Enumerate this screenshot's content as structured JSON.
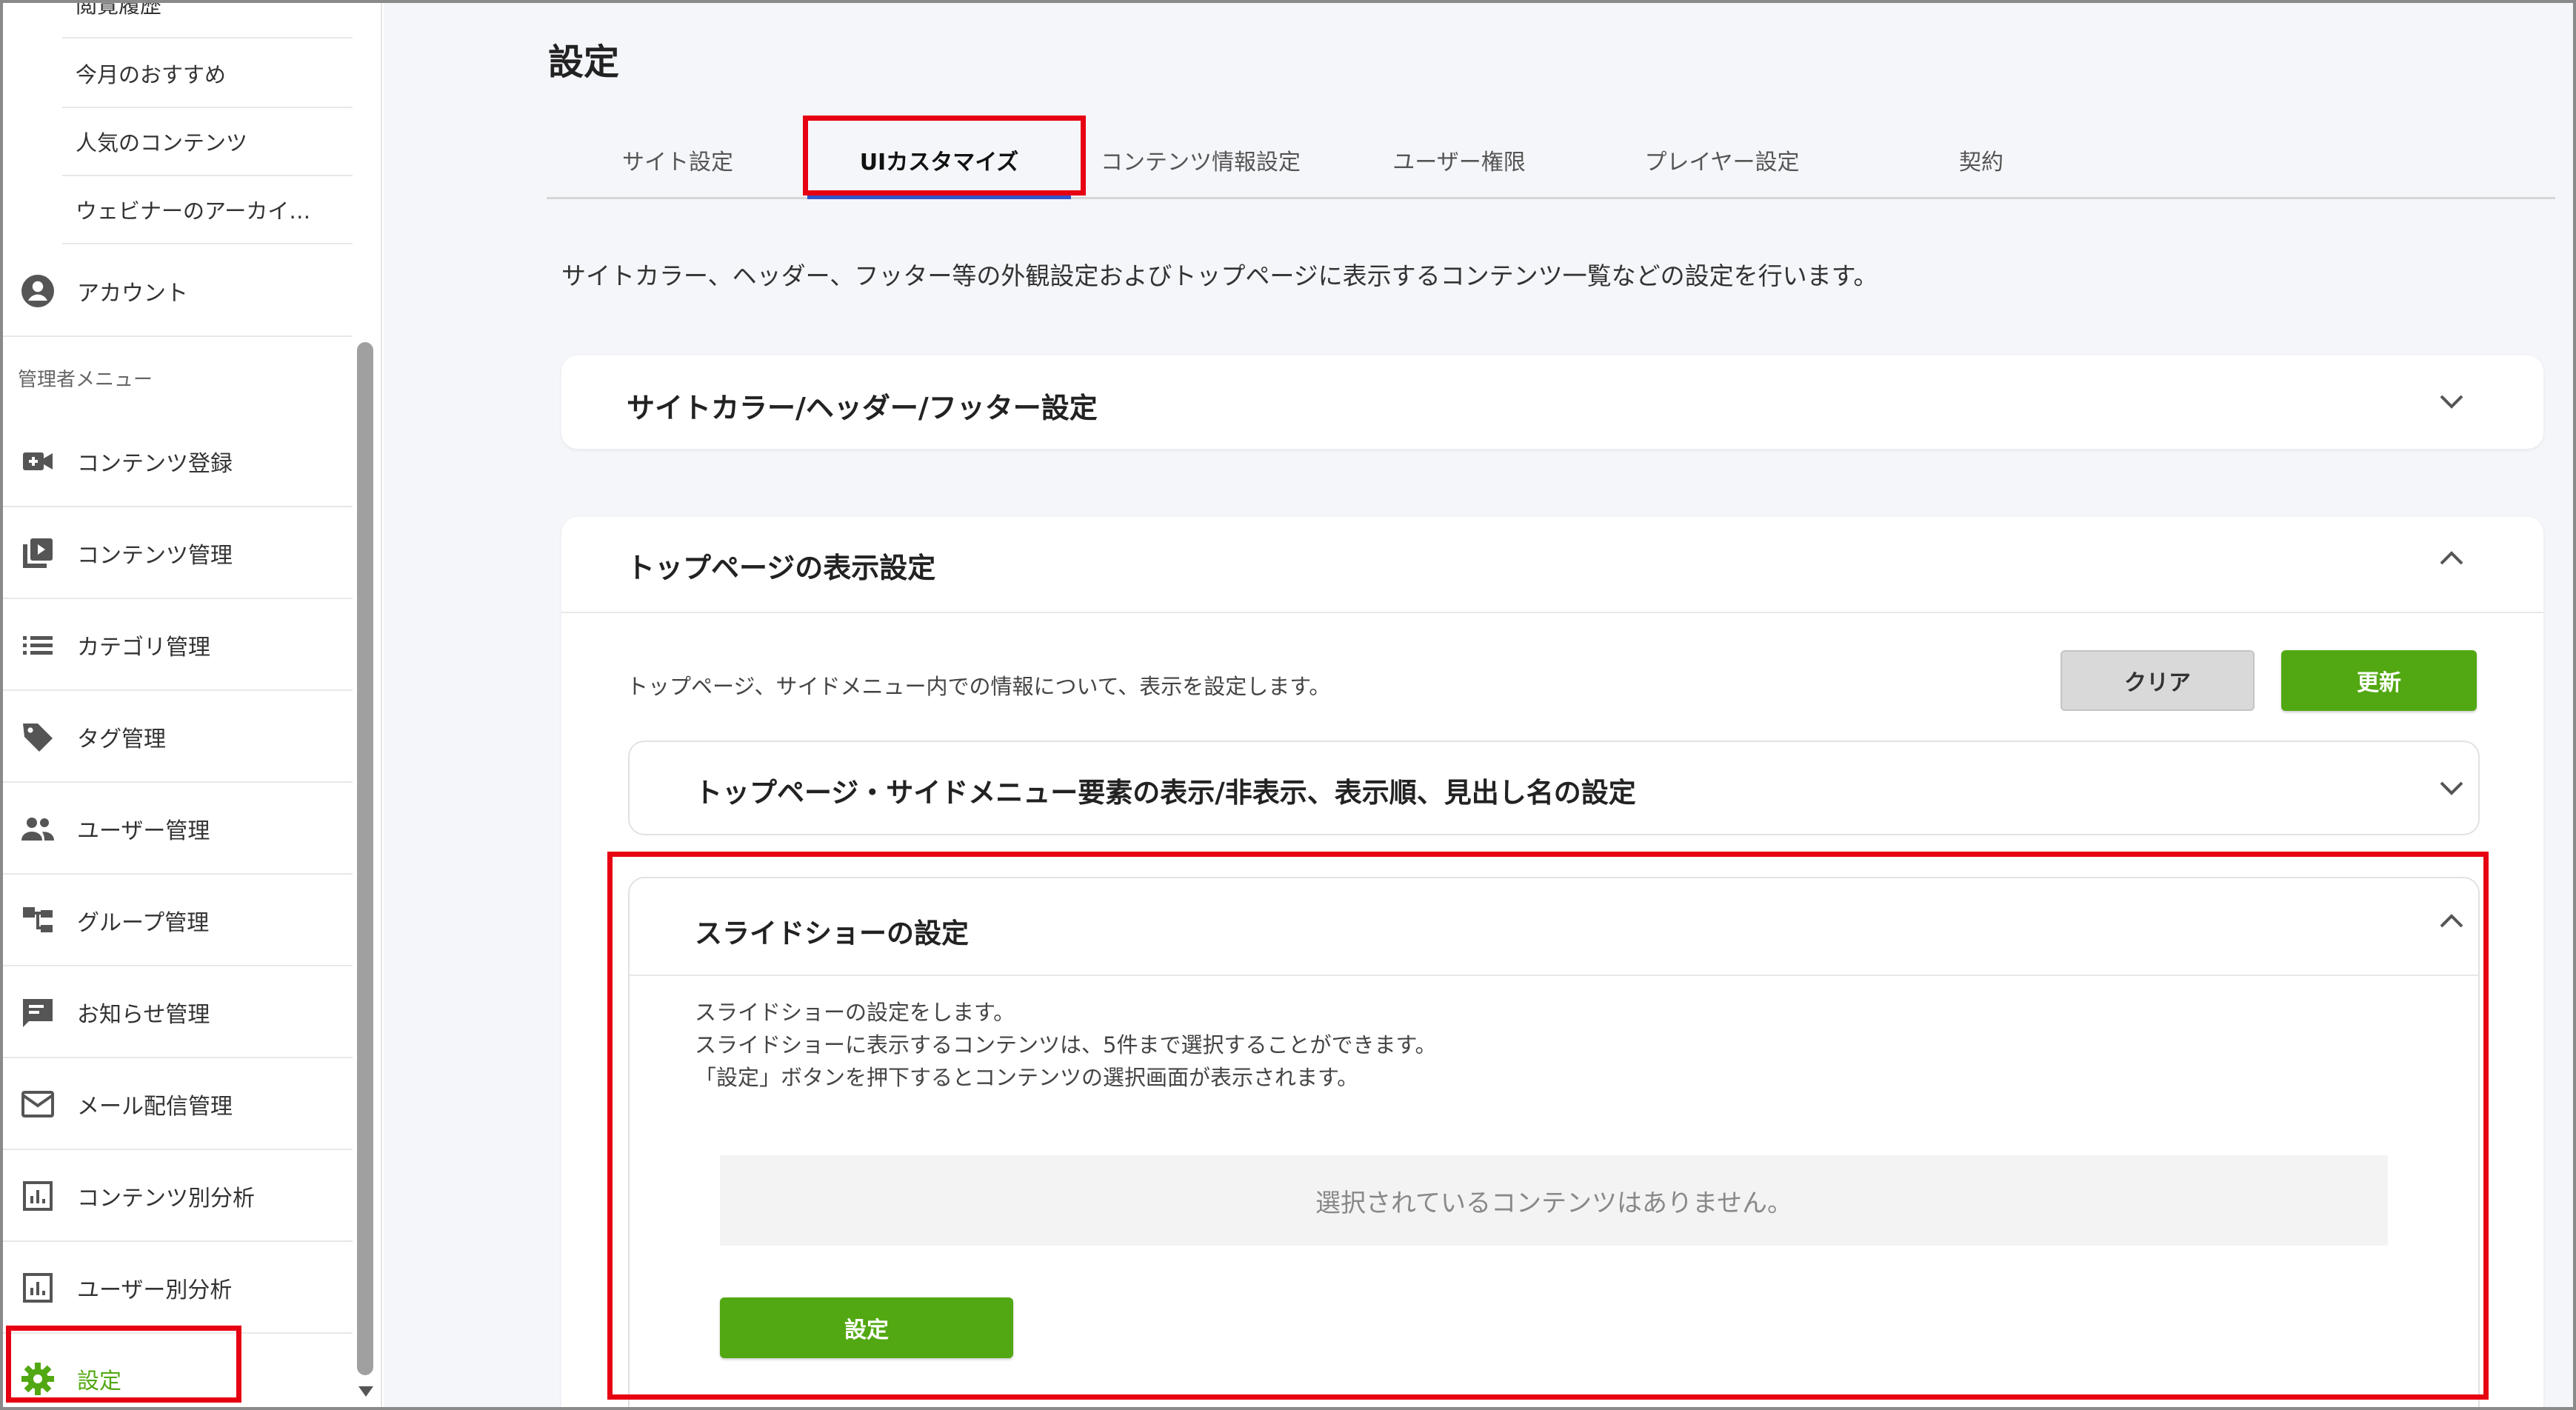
{
  "sidebar": {
    "sub_items": [
      {
        "label": "閲覧履歴"
      },
      {
        "label": "今月のおすすめ"
      },
      {
        "label": "人気のコンテンツ"
      },
      {
        "label": "ウェビナーのアーカイ…"
      }
    ],
    "account_label": "アカウント",
    "admin_section_label": "管理者メニュー",
    "admin_items": [
      {
        "label": "コンテンツ登録",
        "icon": "video-add-icon"
      },
      {
        "label": "コンテンツ管理",
        "icon": "video-library-icon"
      },
      {
        "label": "カテゴリ管理",
        "icon": "list-icon"
      },
      {
        "label": "タグ管理",
        "icon": "tag-icon"
      },
      {
        "label": "ユーザー管理",
        "icon": "people-icon"
      },
      {
        "label": "グループ管理",
        "icon": "hierarchy-icon"
      },
      {
        "label": "お知らせ管理",
        "icon": "announcement-icon"
      },
      {
        "label": "メール配信管理",
        "icon": "mail-icon"
      },
      {
        "label": "コンテンツ別分析",
        "icon": "analytics-icon"
      },
      {
        "label": "ユーザー別分析",
        "icon": "analytics-icon"
      },
      {
        "label": "設定",
        "icon": "gear-icon"
      }
    ]
  },
  "main": {
    "title": "設定",
    "tabs": [
      {
        "label": "サイト設定"
      },
      {
        "label": "UIカスタマイズ"
      },
      {
        "label": "コンテンツ情報設定"
      },
      {
        "label": "ユーザー権限"
      },
      {
        "label": "プレイヤー設定"
      },
      {
        "label": "契約"
      }
    ],
    "active_tab": "UIカスタマイズ",
    "description": "サイトカラー、ヘッダー、フッター等の外観設定およびトップページに表示するコンテンツ一覧などの設定を行います。",
    "section_colors": {
      "title": "サイトカラー/ヘッダー/フッター設定"
    },
    "section_top": {
      "title": "トップページの表示設定",
      "description": "トップページ、サイドメニュー内での情報について、表示を設定します。",
      "clear_label": "クリア",
      "update_label": "更新",
      "sub_elements_title": "トップページ・サイドメニュー要素の表示/非表示、表示順、見出し名の設定",
      "slideshow": {
        "title": "スライドショーの設定",
        "desc_lines": [
          "スライドショーの設定をします。",
          "スライドショーに表示するコンテンツは、5件まで選択することができます。",
          "「設定」ボタンを押下するとコンテンツの選択画面が表示されます。"
        ],
        "empty_message": "選択されているコンテンツはありません。",
        "set_button_label": "設定"
      }
    }
  },
  "colors": {
    "accent_green": "#52a812",
    "highlight_red": "#e60012",
    "tab_underline": "#3355cc",
    "background": "#f5f6fa"
  }
}
